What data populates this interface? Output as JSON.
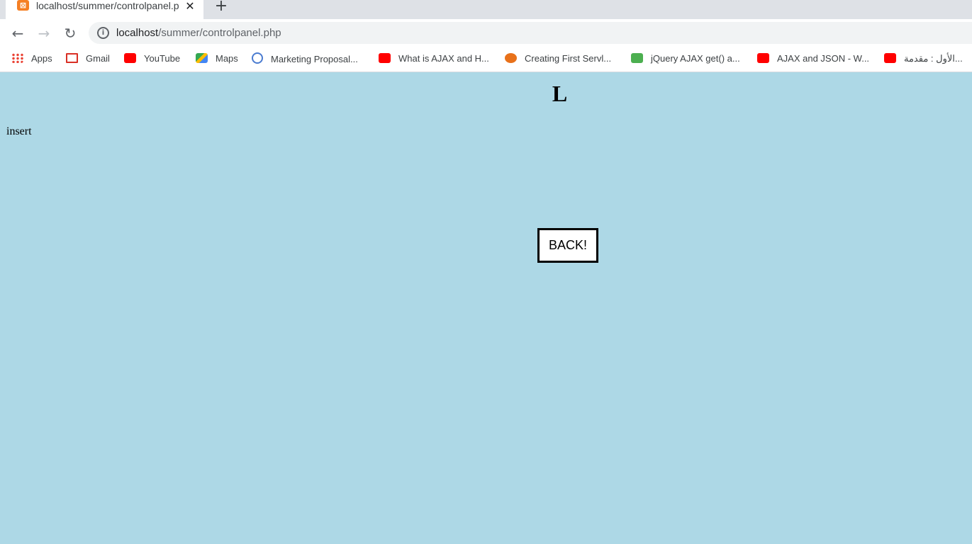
{
  "browser": {
    "tab": {
      "title": "localhost/summer/controlpanel.p",
      "close_icon": "close-icon",
      "favicon": "xampp-favicon"
    },
    "new_tab_label": "+",
    "address": {
      "host": "localhost",
      "path": "/summer/controlpanel.php"
    },
    "bookmarks": [
      {
        "label": "Apps",
        "icon": "apps-grid-icon"
      },
      {
        "label": "Gmail",
        "icon": "gmail-icon"
      },
      {
        "label": "YouTube",
        "icon": "youtube-icon"
      },
      {
        "label": "Maps",
        "icon": "maps-icon"
      },
      {
        "label": "Marketing Proposal...",
        "icon": "globe-icon"
      },
      {
        "label": "What is AJAX and H...",
        "icon": "youtube-icon"
      },
      {
        "label": "Creating First Servl...",
        "icon": "tutorial-icon"
      },
      {
        "label": "jQuery AJAX get() a...",
        "icon": "w3schools-icon"
      },
      {
        "label": "AJAX and JSON - W...",
        "icon": "youtube-icon"
      },
      {
        "label": "الأول : مقدمة...",
        "icon": "youtube-icon"
      }
    ]
  },
  "page": {
    "heading": "L",
    "insert_link": "insert",
    "back_button": "BACK!",
    "background_color": "#add8e6"
  }
}
